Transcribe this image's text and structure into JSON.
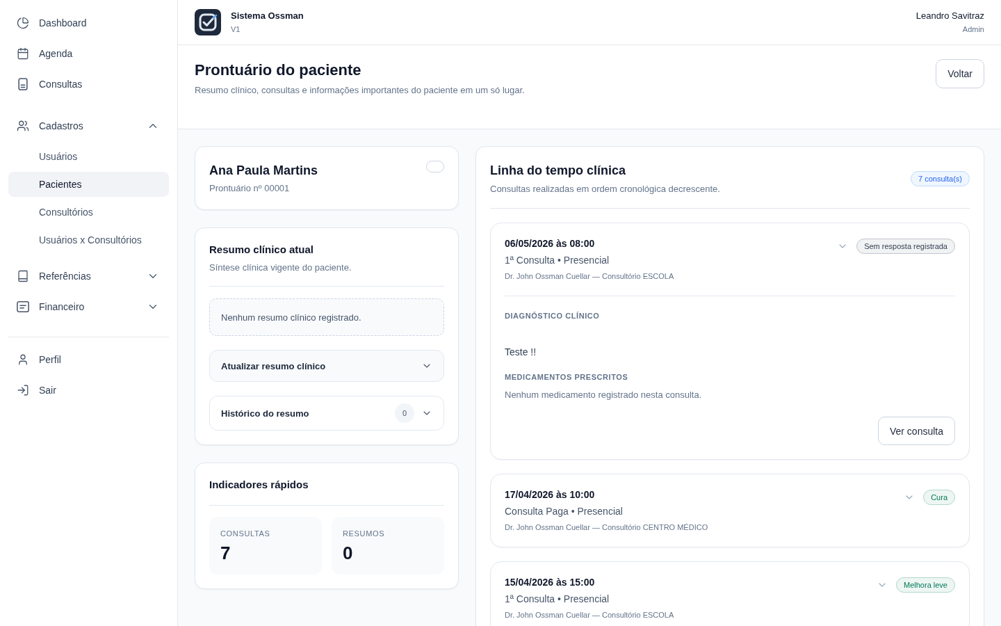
{
  "app": {
    "name": "Sistema Ossman",
    "version": "V1"
  },
  "user": {
    "name": "Leandro Savitraz",
    "role": "Admin"
  },
  "sidebar": {
    "groups": [
      {
        "items": [
          {
            "label": "Dashboard",
            "selected": false
          },
          {
            "label": "Agenda",
            "selected": false
          },
          {
            "label": "Consultas",
            "selected": false
          }
        ]
      },
      {
        "items": [
          {
            "label": "Cadastros",
            "selected": false,
            "expanded": true,
            "children": [
              {
                "label": "Usuários",
                "selected": false
              },
              {
                "label": "Pacientes",
                "selected": true
              },
              {
                "label": "Consultórios",
                "selected": false
              },
              {
                "label": "Usuários x Consultórios",
                "selected": false
              }
            ]
          },
          {
            "label": "Referências",
            "selected": false,
            "expanded": false
          },
          {
            "label": "Financeiro",
            "selected": false,
            "expanded": false
          }
        ]
      },
      {
        "items": [
          {
            "label": "Perfil",
            "selected": false
          },
          {
            "label": "Sair",
            "selected": false
          }
        ]
      }
    ]
  },
  "page": {
    "title": "Prontuário do paciente",
    "subtitle": "Resumo clínico, consultas e informações importantes do paciente em um só lugar.",
    "back_button": "Voltar"
  },
  "patient": {
    "name": "Ana Paula Martins",
    "record": "Prontuário nº 00001"
  },
  "summary": {
    "title": "Resumo clínico atual",
    "subtitle": "Síntese clínica vigente do paciente.",
    "empty_text": "Nenhum resumo clínico registrado.",
    "sections": [
      {
        "kind": "form",
        "label": "Atualizar resumo clínico",
        "expanded": false
      },
      {
        "kind": "history",
        "label": "Histórico do resumo",
        "count": "0",
        "expanded": false
      }
    ]
  },
  "indicators": {
    "title": "Indicadores rápidos",
    "tiles": [
      {
        "label": "CONSULTAS",
        "value": "7"
      },
      {
        "label": "RESUMOS",
        "value": "0"
      }
    ]
  },
  "timeline": {
    "title": "Linha do tempo clínica",
    "subtitle": "Consultas realizadas em ordem cronológica decrescente.",
    "badge": "7 consulta(s)",
    "entries": [
      {
        "datetime": "06/05/2026 às 08:00",
        "type": "1ª Consulta • Presencial",
        "doctor": "Dr. John Ossman Cuellar — Consultório ESCOLA",
        "outcome": {
          "label": "Sem resposta registrada",
          "color": "#334155"
        },
        "expanded": true,
        "details": {
          "diagnosis_label": "DIAGNÓSTICO CLÍNICO",
          "diagnosis": "Teste !!",
          "medications_label": "MEDICAMENTOS PRESCRITOS",
          "medications": "Nenhum medicamento registrado nesta consulta.",
          "button": "Ver consulta"
        }
      },
      {
        "datetime": "17/04/2026 às 10:00",
        "type": "Consulta Paga • Presencial",
        "doctor": "Dr. John Ossman Cuellar — Consultório CENTRO MÉDICO",
        "outcome": {
          "label": "Cura",
          "color": "#047857"
        },
        "expanded": false
      },
      {
        "datetime": "15/04/2026 às 15:00",
        "type": "1ª Consulta • Presencial",
        "doctor": "Dr. John Ossman Cuellar — Consultório ESCOLA",
        "outcome": {
          "label": "Melhora leve",
          "color": "#047857"
        },
        "expanded": false
      }
    ]
  }
}
